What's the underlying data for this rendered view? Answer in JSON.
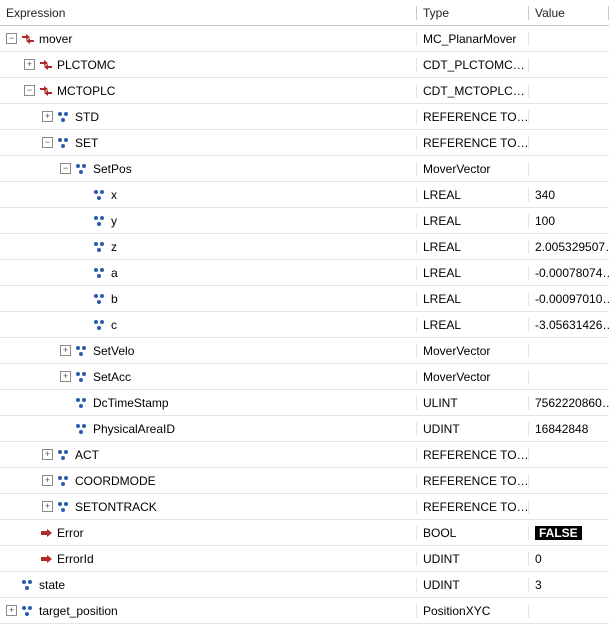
{
  "headers": {
    "expr": "Expression",
    "type": "Type",
    "value": "Value"
  },
  "rows": [
    {
      "depth": 0,
      "toggle": "-",
      "icon": "inout",
      "label": "mover",
      "type": "MC_PlanarMover",
      "value": ""
    },
    {
      "depth": 1,
      "toggle": "+",
      "icon": "inout",
      "label": "PLCTOMC",
      "type": "CDT_PLCTOMC…",
      "value": ""
    },
    {
      "depth": 1,
      "toggle": "-",
      "icon": "inout",
      "label": "MCTOPLC",
      "type": "CDT_MCTOPLC…",
      "value": ""
    },
    {
      "depth": 2,
      "toggle": "+",
      "icon": "var",
      "label": "STD",
      "type": "REFERENCE TO…",
      "value": ""
    },
    {
      "depth": 2,
      "toggle": "-",
      "icon": "var",
      "label": "SET",
      "type": "REFERENCE TO…",
      "value": ""
    },
    {
      "depth": 3,
      "toggle": "-",
      "icon": "var",
      "label": "SetPos",
      "type": "MoverVector",
      "value": ""
    },
    {
      "depth": 4,
      "toggle": "",
      "icon": "var",
      "label": "x",
      "type": "LREAL",
      "value": "340"
    },
    {
      "depth": 4,
      "toggle": "",
      "icon": "var",
      "label": "y",
      "type": "LREAL",
      "value": "100"
    },
    {
      "depth": 4,
      "toggle": "",
      "icon": "var",
      "label": "z",
      "type": "LREAL",
      "value": "2.005329507…"
    },
    {
      "depth": 4,
      "toggle": "",
      "icon": "var",
      "label": "a",
      "type": "LREAL",
      "value": "-0.00078074…"
    },
    {
      "depth": 4,
      "toggle": "",
      "icon": "var",
      "label": "b",
      "type": "LREAL",
      "value": "-0.00097010…"
    },
    {
      "depth": 4,
      "toggle": "",
      "icon": "var",
      "label": "c",
      "type": "LREAL",
      "value": "-3.05631426…"
    },
    {
      "depth": 3,
      "toggle": "+",
      "icon": "var",
      "label": "SetVelo",
      "type": "MoverVector",
      "value": ""
    },
    {
      "depth": 3,
      "toggle": "+",
      "icon": "var",
      "label": "SetAcc",
      "type": "MoverVector",
      "value": ""
    },
    {
      "depth": 3,
      "toggle": "",
      "icon": "var",
      "label": "DcTimeStamp",
      "type": "ULINT",
      "value": "7562220860…"
    },
    {
      "depth": 3,
      "toggle": "",
      "icon": "var",
      "label": "PhysicalAreaID",
      "type": "UDINT",
      "value": "16842848"
    },
    {
      "depth": 2,
      "toggle": "+",
      "icon": "var",
      "label": "ACT",
      "type": "REFERENCE TO…",
      "value": ""
    },
    {
      "depth": 2,
      "toggle": "+",
      "icon": "var",
      "label": "COORDMODE",
      "type": "REFERENCE TO…",
      "value": ""
    },
    {
      "depth": 2,
      "toggle": "+",
      "icon": "var",
      "label": "SETONTRACK",
      "type": "REFERENCE TO…",
      "value": ""
    },
    {
      "depth": 1,
      "toggle": "",
      "icon": "output",
      "label": "Error",
      "type": "BOOL",
      "value": "FALSE",
      "badge": true
    },
    {
      "depth": 1,
      "toggle": "",
      "icon": "output",
      "label": "ErrorId",
      "type": "UDINT",
      "value": "0"
    },
    {
      "depth": 0,
      "toggle": "",
      "icon": "var",
      "label": "state",
      "type": "UDINT",
      "value": "3"
    },
    {
      "depth": 0,
      "toggle": "+",
      "icon": "var",
      "label": "target_position",
      "type": "PositionXYC",
      "value": ""
    }
  ]
}
